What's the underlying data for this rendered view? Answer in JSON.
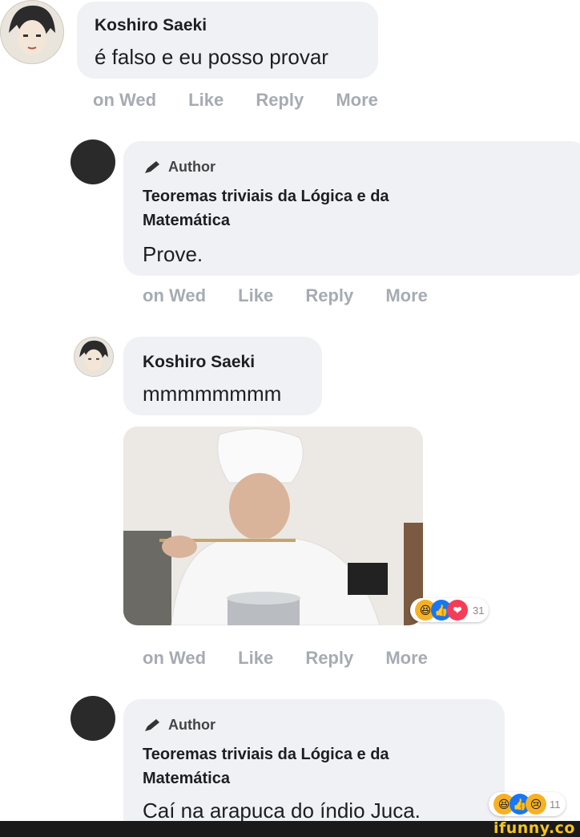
{
  "comments": [
    {
      "author": "Koshiro Saeki",
      "text": "é falso e eu posso provar",
      "meta": {
        "time": "on Wed",
        "like": "Like",
        "reply": "Reply",
        "more": "More"
      }
    },
    {
      "badge": "Author",
      "author": "Teoremas triviais da Lógica e da Matemática",
      "author_line1": "Teoremas triviais da Lógica e da",
      "author_line2": "Matemática",
      "text": "Prove.",
      "meta": {
        "time": "on Wed",
        "like": "Like",
        "reply": "Reply",
        "more": "More"
      }
    },
    {
      "author": "Koshiro Saeki",
      "text": "mmmmmmmm",
      "reaction_count": "31",
      "meta": {
        "time": "on Wed",
        "like": "Like",
        "reply": "Reply",
        "more": "More"
      }
    },
    {
      "badge": "Author",
      "author_line1": "Teoremas triviais da Lógica e da",
      "author_line2": "Matemática",
      "text": "Caí na arapuca do índio Juca.",
      "reaction_count": "11"
    }
  ],
  "watermark": "ifunny.co",
  "colors": {
    "bubble": "#eff1f4",
    "meta": "#a6abb3",
    "haha": "#f7b125",
    "love": "#f33e58",
    "like": "#1877f2"
  }
}
